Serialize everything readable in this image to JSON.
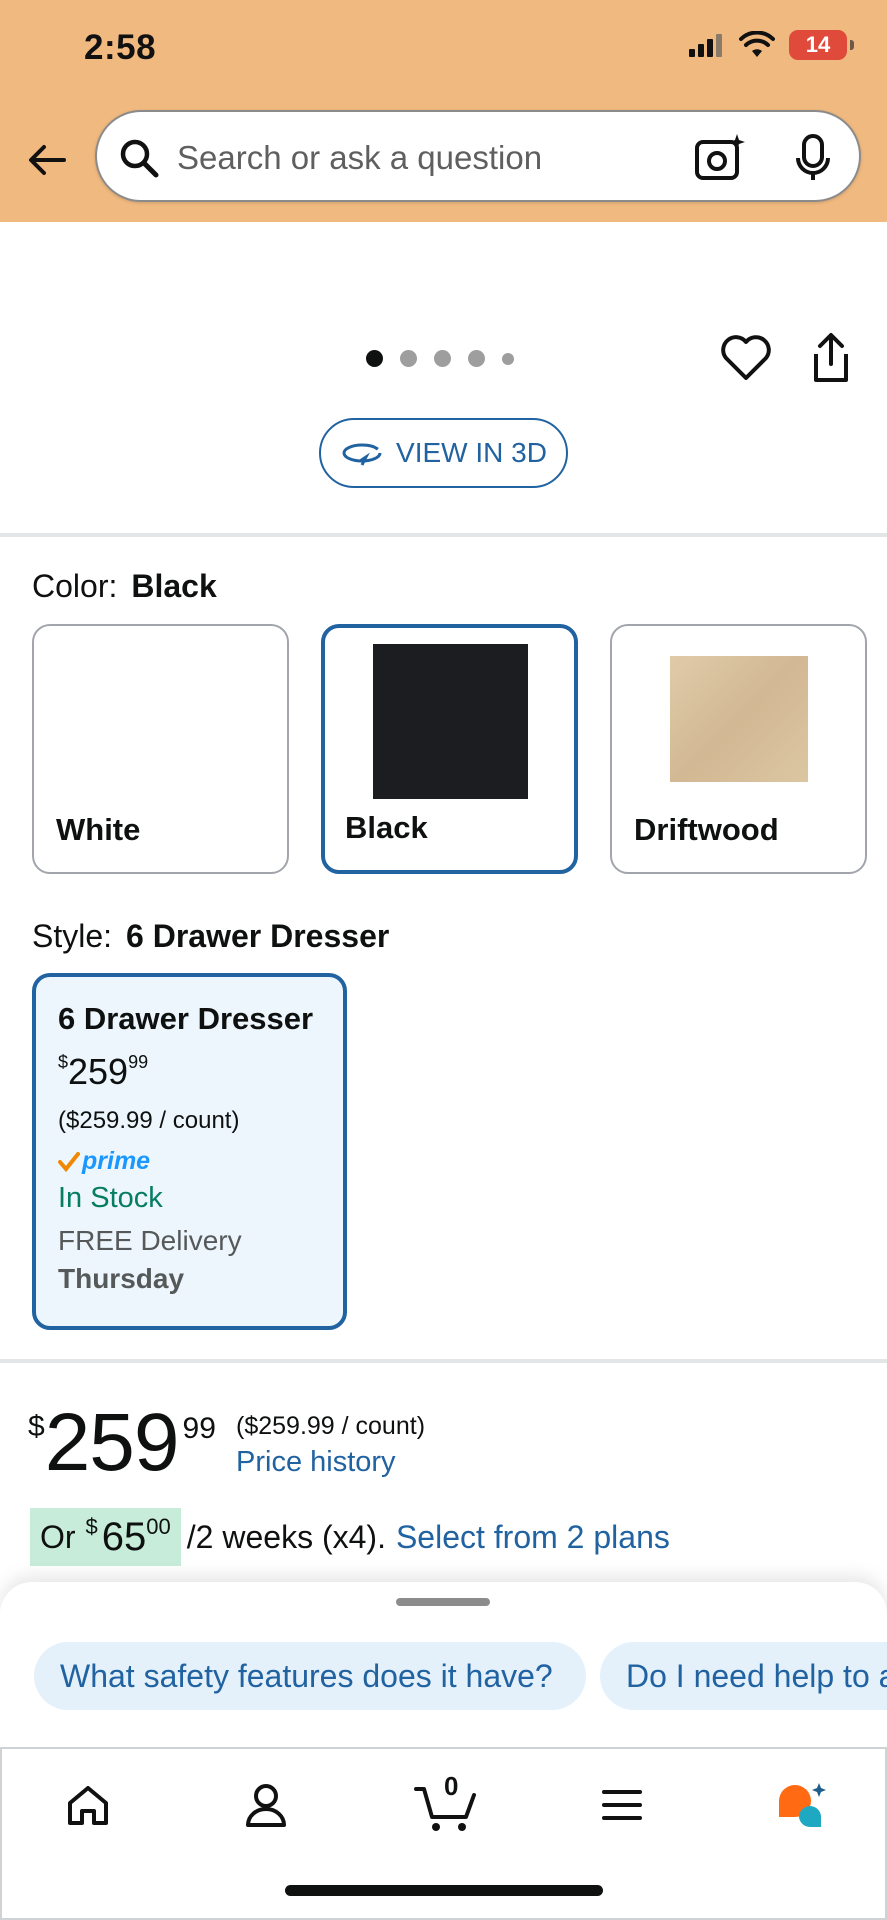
{
  "status_bar": {
    "time": "2:58",
    "battery": "14"
  },
  "header": {
    "search_placeholder": "Search or ask a question",
    "icons": [
      "back-arrow-icon",
      "search-icon",
      "camera-icon",
      "mic-icon"
    ]
  },
  "carousel": {
    "dot_count": 5,
    "active_index": 0,
    "view_3d_label": "VIEW IN 3D"
  },
  "color": {
    "label": "Color:",
    "selected": "Black",
    "options": [
      {
        "name": "White",
        "swatch": "#ffffff"
      },
      {
        "name": "Black",
        "swatch": "#1c1d20"
      },
      {
        "name": "Driftwood",
        "swatch": "#d8c19f"
      }
    ]
  },
  "style": {
    "label": "Style:",
    "selected": "6 Drawer Dresser",
    "card": {
      "title": "6 Drawer Dresser",
      "price_symbol": "$",
      "price_whole": "259",
      "price_fraction": "99",
      "unit_price": "($259.99 / count)",
      "prime": "prime",
      "stock": "In Stock",
      "delivery": "FREE Delivery",
      "delivery_day": "Thursday"
    }
  },
  "price": {
    "symbol": "$",
    "whole": "259",
    "fraction": "99",
    "unit_price": "($259.99 / count)",
    "history_link": "Price history"
  },
  "installment": {
    "prefix": "Or",
    "symbol": "$",
    "amount": "65",
    "fraction": "00",
    "suffix": "/2 weeks (x4).",
    "link": "Select from 2 plans"
  },
  "suggestions": [
    "What safety features does it have?",
    "Do I need help to a"
  ],
  "tabbar": {
    "tabs": [
      "home-icon",
      "account-icon",
      "cart-icon",
      "menu-icon",
      "rufus-icon"
    ],
    "cart_count": "0"
  },
  "colors": {
    "header": "#f0b97f",
    "link": "#2162a1",
    "in_stock": "#067d62",
    "prime": "#1a98ff",
    "installment_highlight": "#c7ecda"
  }
}
